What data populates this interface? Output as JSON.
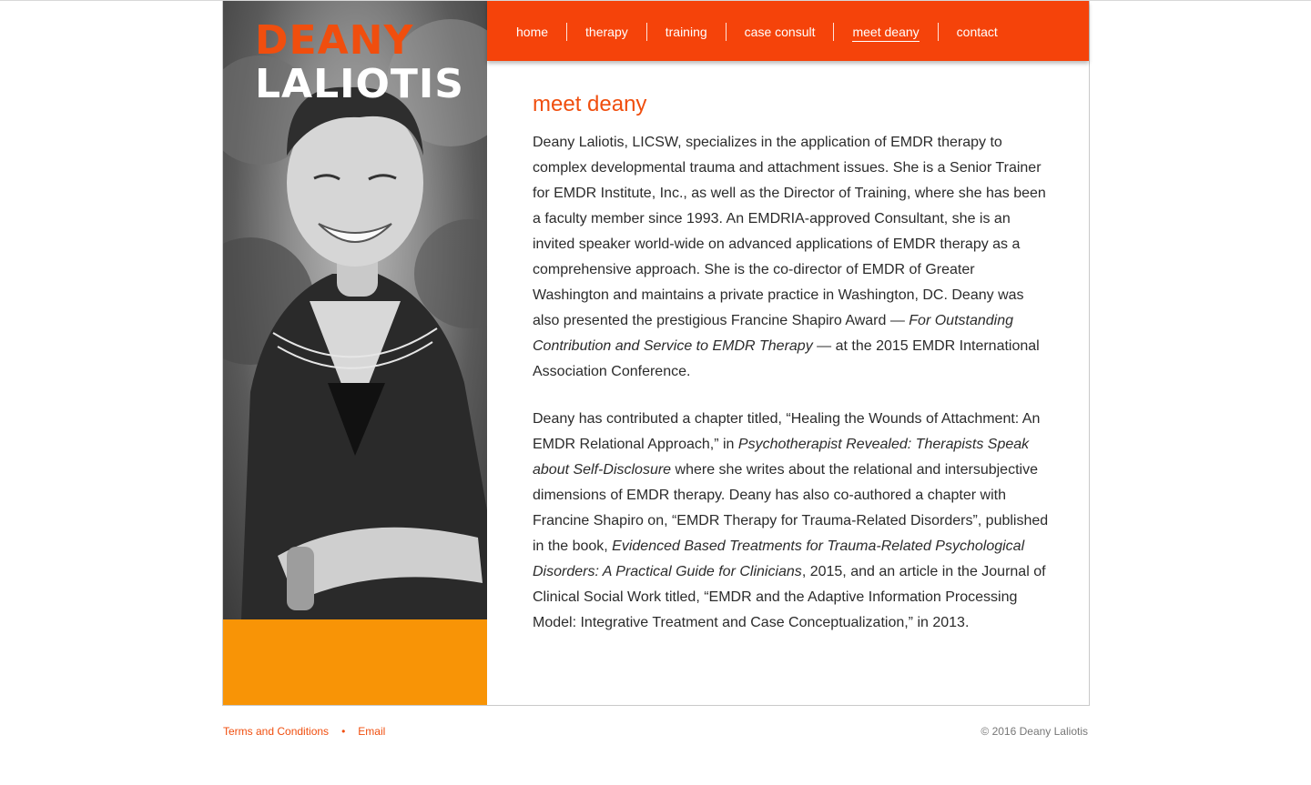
{
  "brand": {
    "first_name": "DEANY",
    "last_name": "LALIOTIS"
  },
  "nav": {
    "items": [
      {
        "label": "home"
      },
      {
        "label": "therapy"
      },
      {
        "label": "training"
      },
      {
        "label": "case consult"
      },
      {
        "label": "meet deany",
        "active": true
      },
      {
        "label": "contact"
      }
    ]
  },
  "main": {
    "title": "meet deany",
    "p1": {
      "a": "Deany Laliotis, LICSW, specializes in the application of EMDR therapy to complex developmental trauma and attachment issues. She is a Senior Trainer for EMDR Institute, Inc., as well as the Director of Training, where she has been a faculty member since 1993. An EMDRIA-approved Consultant, she is an invited speaker world-wide on advanced applications of EMDR therapy as a comprehensive approach. She is the co-director of EMDR of Greater Washington and maintains a private practice in Washington, DC. Deany was also presented the prestigious Francine Shapiro Award — ",
      "em": "For Outstanding Contribution and Service to EMDR Therapy",
      "b": " — at the 2015 EMDR International Association Conference."
    },
    "p2": {
      "a": "Deany has contributed a chapter titled, “Healing the Wounds of Attachment: An EMDR Relational Approach,” in ",
      "em1": "Psychotherapist Revealed: Therapists Speak about Self-Disclosure",
      "b": " where she writes about the relational and intersubjective dimensions of EMDR therapy. Deany has also co-authored a chapter with Francine Shapiro on, “EMDR Therapy for Trauma-Related Disorders”, published in the book, ",
      "em2": "Evidenced Based Treatments for Trauma-Related Psychological Disorders: A Practical Guide for Clinicians",
      "c": ", 2015, and an article in the Journal of Clinical Social Work titled, “EMDR and the Adaptive Information Processing Model: Integrative Treatment and Case Conceptualization,” in 2013."
    }
  },
  "footer": {
    "terms": "Terms and Conditions",
    "separator": "•",
    "email": "Email",
    "copyright": "© 2016 Deany Laliotis"
  },
  "colors": {
    "accent": "#f5430a",
    "secondary": "#f89406"
  }
}
